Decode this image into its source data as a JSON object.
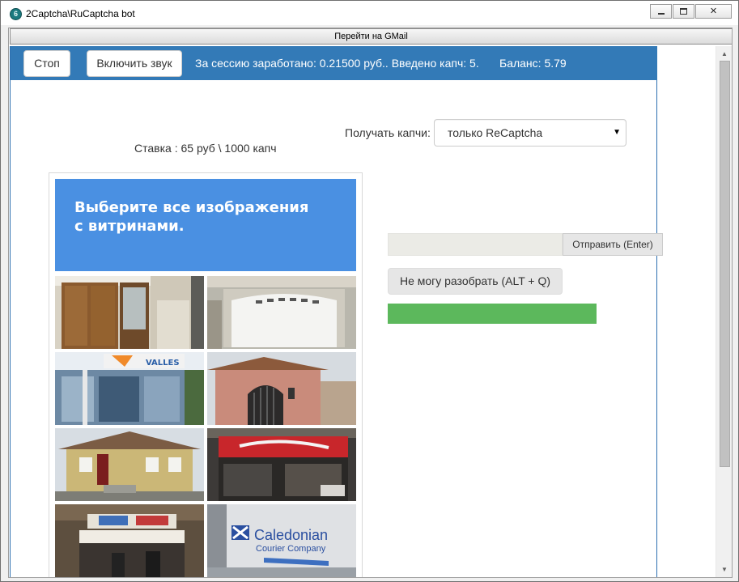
{
  "window": {
    "title": "2Captcha\\RuCaptcha bot",
    "app_icon": "lock-icon",
    "controls": [
      "minimize-icon",
      "maximize-icon",
      "close-icon"
    ],
    "close_glyph": "✕"
  },
  "gmail_button": "Перейти на GMail",
  "topbar": {
    "stop_label": "Стоп",
    "sound_label": "Включить звук",
    "session_text": "За сессию заработано: 0.21500 руб.. Введено капч: 5.",
    "balance_text": "Баланс: 5.79",
    "accent_color": "#337ab7"
  },
  "rate_text": "Ставка : 65 руб \\ 1000 капч",
  "receive": {
    "label": "Получать капчи:",
    "selected": "только ReCaptcha"
  },
  "captcha": {
    "instruction": "Выберите все изображения с витринами.",
    "header_color": "#4a90e2",
    "tiles": [
      "wooden-door-image",
      "garage-door-image",
      "shop-front-image",
      "gated-house-image",
      "yellow-house-image",
      "storefront-sign-image",
      "kiosk-image",
      "caledonian-van-image"
    ],
    "tile_text": {
      "caledonian_line1": "Caledonian",
      "caledonian_line2": "Courier Company",
      "valles": "VALLES"
    }
  },
  "answer": {
    "input_value": "",
    "send_label": "Отправить (Enter)",
    "cant_label": "Не могу разобрать (ALT + Q)",
    "progress_fraction": 1.0,
    "progress_color": "#5cb85c"
  },
  "scrollbar": {
    "up_glyph": "▲",
    "down_glyph": "▼"
  }
}
